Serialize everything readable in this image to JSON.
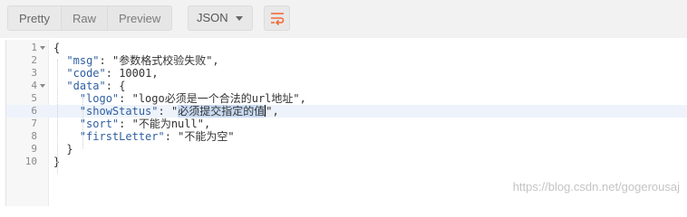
{
  "toolbar": {
    "tabs": [
      {
        "label": "Pretty",
        "active": true
      },
      {
        "label": "Raw",
        "active": false
      },
      {
        "label": "Preview",
        "active": false
      }
    ],
    "format": {
      "selected": "JSON",
      "icon": "chevron-down-icon"
    },
    "wrap_icon": "wrap-lines-icon",
    "colors": {
      "accent": "#f26b3a"
    }
  },
  "editor": {
    "current_line": 6,
    "lines": [
      {
        "number": "1",
        "foldable": true,
        "tokens": [
          {
            "t": "punct",
            "v": "{"
          }
        ]
      },
      {
        "number": "2",
        "foldable": false,
        "tokens": [
          {
            "t": "key",
            "v": "\"msg\""
          },
          {
            "t": "punct",
            "v": ": "
          },
          {
            "t": "str",
            "v": "\"参数格式校验失败\""
          },
          {
            "t": "punct",
            "v": ","
          }
        ]
      },
      {
        "number": "3",
        "foldable": false,
        "tokens": [
          {
            "t": "key",
            "v": "\"code\""
          },
          {
            "t": "punct",
            "v": ": "
          },
          {
            "t": "num",
            "v": "10001"
          },
          {
            "t": "punct",
            "v": ","
          }
        ]
      },
      {
        "number": "4",
        "foldable": true,
        "tokens": [
          {
            "t": "key",
            "v": "\"data\""
          },
          {
            "t": "punct",
            "v": ": {"
          }
        ]
      },
      {
        "number": "5",
        "foldable": false,
        "tokens": [
          {
            "t": "key",
            "v": "\"logo\""
          },
          {
            "t": "punct",
            "v": ": "
          },
          {
            "t": "str",
            "v": "\"logo必须是一个合法的url地址\""
          },
          {
            "t": "punct",
            "v": ","
          }
        ]
      },
      {
        "number": "6",
        "foldable": false,
        "tokens": [
          {
            "t": "key",
            "v": "\"showStatus\""
          },
          {
            "t": "punct",
            "v": ": "
          },
          {
            "t": "str",
            "v": "\""
          },
          {
            "t": "sel",
            "v": "必须提交指定的值"
          },
          {
            "t": "cursor",
            "v": ""
          },
          {
            "t": "str",
            "v": "\""
          },
          {
            "t": "punct",
            "v": ","
          }
        ]
      },
      {
        "number": "7",
        "foldable": false,
        "tokens": [
          {
            "t": "key",
            "v": "\"sort\""
          },
          {
            "t": "punct",
            "v": ": "
          },
          {
            "t": "str",
            "v": "\"不能为null\""
          },
          {
            "t": "punct",
            "v": ","
          }
        ]
      },
      {
        "number": "8",
        "foldable": false,
        "tokens": [
          {
            "t": "key",
            "v": "\"firstLetter\""
          },
          {
            "t": "punct",
            "v": ": "
          },
          {
            "t": "str",
            "v": "\"不能为空\""
          }
        ]
      },
      {
        "number": "9",
        "foldable": false,
        "tokens": [
          {
            "t": "punct",
            "v": "}"
          }
        ]
      },
      {
        "number": "10",
        "foldable": false,
        "tokens": [
          {
            "t": "punct",
            "v": "}"
          }
        ]
      }
    ]
  },
  "watermark": "https://blog.csdn.net/gogerousaj"
}
